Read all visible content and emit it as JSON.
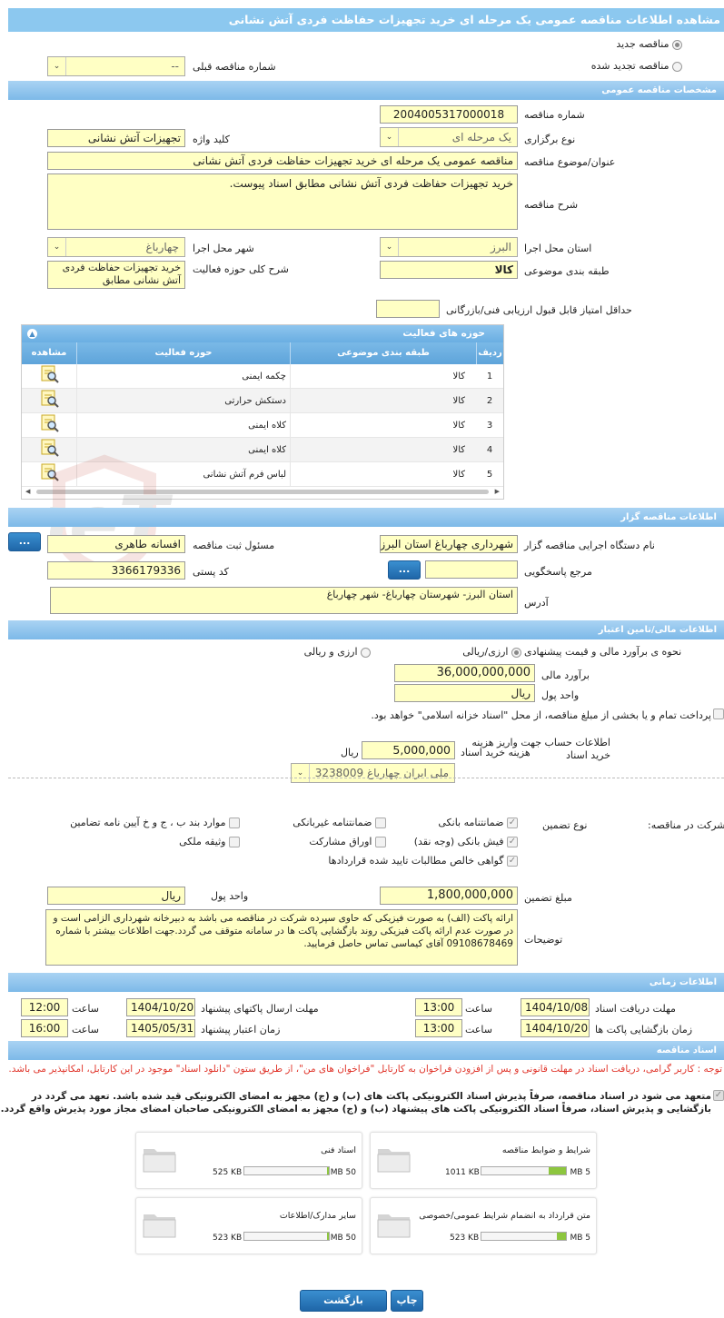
{
  "page_title": "مشاهده اطلاعات مناقصه عمومی یک مرحله ای خرید تجهیزات حفاظت فردی آتش نشانی",
  "tender_type": {
    "new": "مناقصه جدید",
    "renewed": "مناقصه تجدید شده",
    "prev_label": "شماره مناقصه قبلی",
    "prev_value": "--"
  },
  "sections": {
    "general": "مشخصات مناقصه عمومی",
    "organizer": "اطلاعات مناقصه گزار",
    "financial": "اطلاعات مالی/تامین اعتبار",
    "timing": "اطلاعات زمانی",
    "docs": "اسناد مناقصه"
  },
  "general": {
    "number_label": "شماره مناقصه",
    "number": "2004005317000018",
    "holding_label": "نوع برگزاری",
    "holding": "یک مرحله ای",
    "keyword_label": "کلید واژه",
    "keyword": "تجهیزات آتش نشانی",
    "subject_label": "عنوان/موضوع مناقصه",
    "subject": "مناقصه عمومی یک مرحله ای خرید تجهیزات حفاظت فردی  آتش نشانی",
    "desc_label": "شرح مناقصه",
    "desc": "خرید تجهیزات حفاظت فردی  آتش نشانی مطابق اسناد پیوست.",
    "province_label": "استان محل اجرا",
    "province": "البرز",
    "city_label": "شهر محل اجرا",
    "city": "چهارباغ",
    "category_label": "طبقه بندی موضوعی",
    "category": "کالا",
    "scope_label": "شرح کلی حوزه فعالیت",
    "scope": "خرید تجهیزات حفاظت فردی  آتش نشانی مطابق",
    "min_score_label": "حداقل امتیاز قابل قبول ارزیابی فنی/بازرگانی",
    "min_score": ""
  },
  "activity": {
    "title": "حوزه های فعالیت",
    "columns": {
      "row": "ردیف",
      "category": "طبقه بندی موضوعی",
      "field": "حوزه فعالیت",
      "view": "مشاهده"
    },
    "rows": [
      {
        "n": "1",
        "category": "کالا",
        "field": "چکمه ایمنی"
      },
      {
        "n": "2",
        "category": "کالا",
        "field": "دستکش حرارتی"
      },
      {
        "n": "3",
        "category": "کالا",
        "field": "کلاه ایمنی"
      },
      {
        "n": "4",
        "category": "کالا",
        "field": "کلاه ایمنی"
      },
      {
        "n": "5",
        "category": "کالا",
        "field": "لباس فرم آتش نشانی"
      }
    ]
  },
  "organizer": {
    "exec_label": "نام دستگاه اجرایی مناقصه گزار",
    "exec": "شهرداری چهارباغ استان البرز",
    "registrar_label": "مسئول ثبت مناقصه",
    "registrar": "افسانه طاهری",
    "ref_label": "مرجع پاسخگویی",
    "ref": "",
    "postal_label": "کد پستی",
    "postal": "3366179336",
    "address_label": "آدرس",
    "address": "استان البرز- شهرستان چهارباغ- شهر چهارباغ",
    "more": "..."
  },
  "financial": {
    "estimate_label": "نحوه ی برآورد مالی و قیمت پیشنهادی",
    "opt1": "ارزی/ریالی",
    "opt2": "ارزی و ریالی",
    "amount_label": "برآورد مالی",
    "amount": "36,000,000,000",
    "currency_label": "واحد پول",
    "currency": "ریال",
    "treasury": "پرداخت تمام و یا بخشی از مبلغ مناقصه، از محل \"اسناد خزانه اسلامی\" خواهد بود.",
    "doc_fee_label": "هزینه خرید اسناد",
    "doc_fee": "5,000,000",
    "doc_fee_unit": "ریال",
    "account_label": "اطلاعات حساب جهت واریز هزینه خرید اسناد",
    "account": "ملی ایران چهارباغ 3238009",
    "guarantee_label": "تضمین شرکت در مناقصه:",
    "guarantee_type_label": "نوع تضمین",
    "g": [
      "ضمانتنامه بانکی",
      "ضمانتنامه غیربانکی",
      "موارد بند ب ، ج و خ آیین نامه تضامین",
      "فیش بانکی (وجه نقد)",
      "اوراق مشارکت",
      "وثیقه ملکی",
      "گواهی خالص مطالبات تایید شده قراردادها"
    ],
    "g_amount_label": "مبلغ تضمین",
    "g_amount": "1,800,000,000",
    "g_currency_label": "واحد پول",
    "g_currency": "ریال",
    "notes_label": "توضیحات",
    "notes": "ارائه پاکت (الف) به صورت فیزیکی که حاوی سپرده شرکت در مناقصه می باشد به دبیرخانه شهرداری الزامی است و در صورت عدم ارائه پاکت فیزیکی روند بازگشایی پاکت ها در سامانه متوقف می گردد.جهت اطلاعات بیشتر با شماره 09108678469 آقای کیماسی تماس حاصل فرمایید."
  },
  "timing": {
    "receive_label": "مهلت دریافت اسناد",
    "receive_date": "1404/10/08",
    "receive_time": "13:00",
    "send_label": "مهلت ارسال پاکتهای پیشنهاد",
    "send_date": "1404/10/20",
    "send_time": "12:00",
    "open_label": "زمان بازگشایی پاکت ها",
    "open_date": "1404/10/20",
    "open_time": "13:00",
    "valid_label": "زمان اعتبار پیشنهاد",
    "valid_date": "1405/05/31",
    "valid_time": "16:00",
    "hour": "ساعت"
  },
  "docs": {
    "notice": "توجه : کاربر گرامی، دریافت اسناد در مهلت قانونی و پس از افزودن فراخوان به کارتابل \"فراخوان های من\"، از طریق ستون \"دانلود اسناد\" موجود در این کارتابل، امکانپذیر می باشد.",
    "commit": "متعهد می شود در اسناد مناقصه، صرفاً پذیرش اسناد الکترونیکی پاکت های (ب) و (ج) مجهز به امضای الکترونیکی قید شده باشد. تعهد می گردد در بازگشایی و پذیرش اسناد، صرفاً اسناد الکترونیکی پاکت های پیشنهاد (ب) و (ج) مجهز به امضای الکترونیکی صاحبان امضای مجاز مورد پذیرش واقع گردد.",
    "files": [
      {
        "name": "شرایط و ضوابط مناقصه",
        "size": "1011 KB",
        "max": "5 MB",
        "fill": 0.2
      },
      {
        "name": "اسناد فنی",
        "size": "525 KB",
        "max": "50 MB",
        "fill": 0.01
      },
      {
        "name": "متن قرارداد به انضمام شرایط عمومی/خصوصی",
        "size": "523 KB",
        "max": "5 MB",
        "fill": 0.1
      },
      {
        "name": "سایر مدارک/اطلاعات",
        "size": "523 KB",
        "max": "50 MB",
        "fill": 0.01
      }
    ]
  },
  "buttons": {
    "print": "چاپ",
    "back": "بازگشت"
  },
  "watermark": "AriaTender.neT",
  "colors": {
    "header": "#8cc8ef",
    "field": "#ffffc4",
    "button": "#2774b8",
    "notice": "#e0342a",
    "progress": "#8dc63f"
  }
}
